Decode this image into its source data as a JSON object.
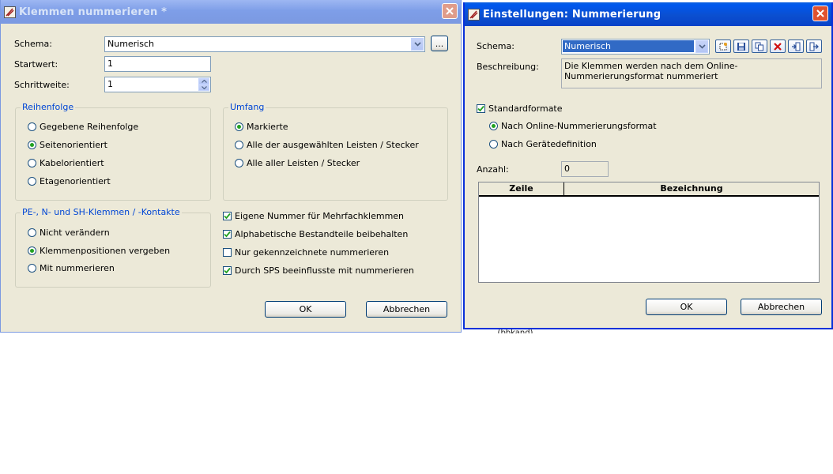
{
  "dialog_left": {
    "title": "Klemmen nummerieren *",
    "schema_label": "Schema:",
    "schema_value": "Numerisch",
    "browse_label": "...",
    "startwert_label": "Startwert:",
    "startwert_value": "1",
    "schrittweite_label": "Schrittweite:",
    "schrittweite_value": "1",
    "reihenfolge": {
      "title": "Reihenfolge",
      "options": [
        "Gegebene Reihenfolge",
        "Seitenorientiert",
        "Kabelorientiert",
        "Etagenorientiert"
      ],
      "selected_index": 1
    },
    "umfang": {
      "title": "Umfang",
      "options": [
        "Markierte",
        "Alle der ausgewählten Leisten / Stecker",
        "Alle aller Leisten / Stecker"
      ],
      "selected_index": 0
    },
    "pe_group": {
      "title": "PE-, N- und SH-Klemmen / -Kontakte",
      "options": [
        "Nicht verändern",
        "Klemmenpositionen vergeben",
        "Mit nummerieren"
      ],
      "selected_index": 1
    },
    "checkboxes": [
      {
        "label": "Eigene Nummer für Mehrfachklemmen",
        "checked": true
      },
      {
        "label": "Alphabetische Bestandteile beibehalten",
        "checked": true
      },
      {
        "label": "Nur gekennzeichnete nummerieren",
        "checked": false
      },
      {
        "label": "Durch SPS beeinflusste mit nummerieren",
        "checked": true
      }
    ],
    "ok_label": "OK",
    "cancel_label": "Abbrechen"
  },
  "dialog_right": {
    "title": "Einstellungen: Nummerierung",
    "schema_label": "Schema:",
    "schema_value": "Numerisch",
    "toolbar_icons": [
      "new-icon",
      "save-icon",
      "copy-icon",
      "delete-icon",
      "import-icon",
      "export-icon"
    ],
    "beschreibung_label": "Beschreibung:",
    "beschreibung_value": "Die Klemmen werden nach dem Online-Nummerierungsformat nummeriert",
    "standardformate_label": "Standardformate",
    "standardformate_checked": true,
    "format_options": [
      "Nach Online-Nummerierungsformat",
      "Nach Gerätedefinition"
    ],
    "format_selected_index": 0,
    "anzahl_label": "Anzahl:",
    "anzahl_value": "0",
    "table_headers": [
      "Zeile",
      "Bezeichnung"
    ],
    "ok_label": "OK",
    "cancel_label": "Abbrechen"
  },
  "background_fragment": "...(bbkand) ..."
}
